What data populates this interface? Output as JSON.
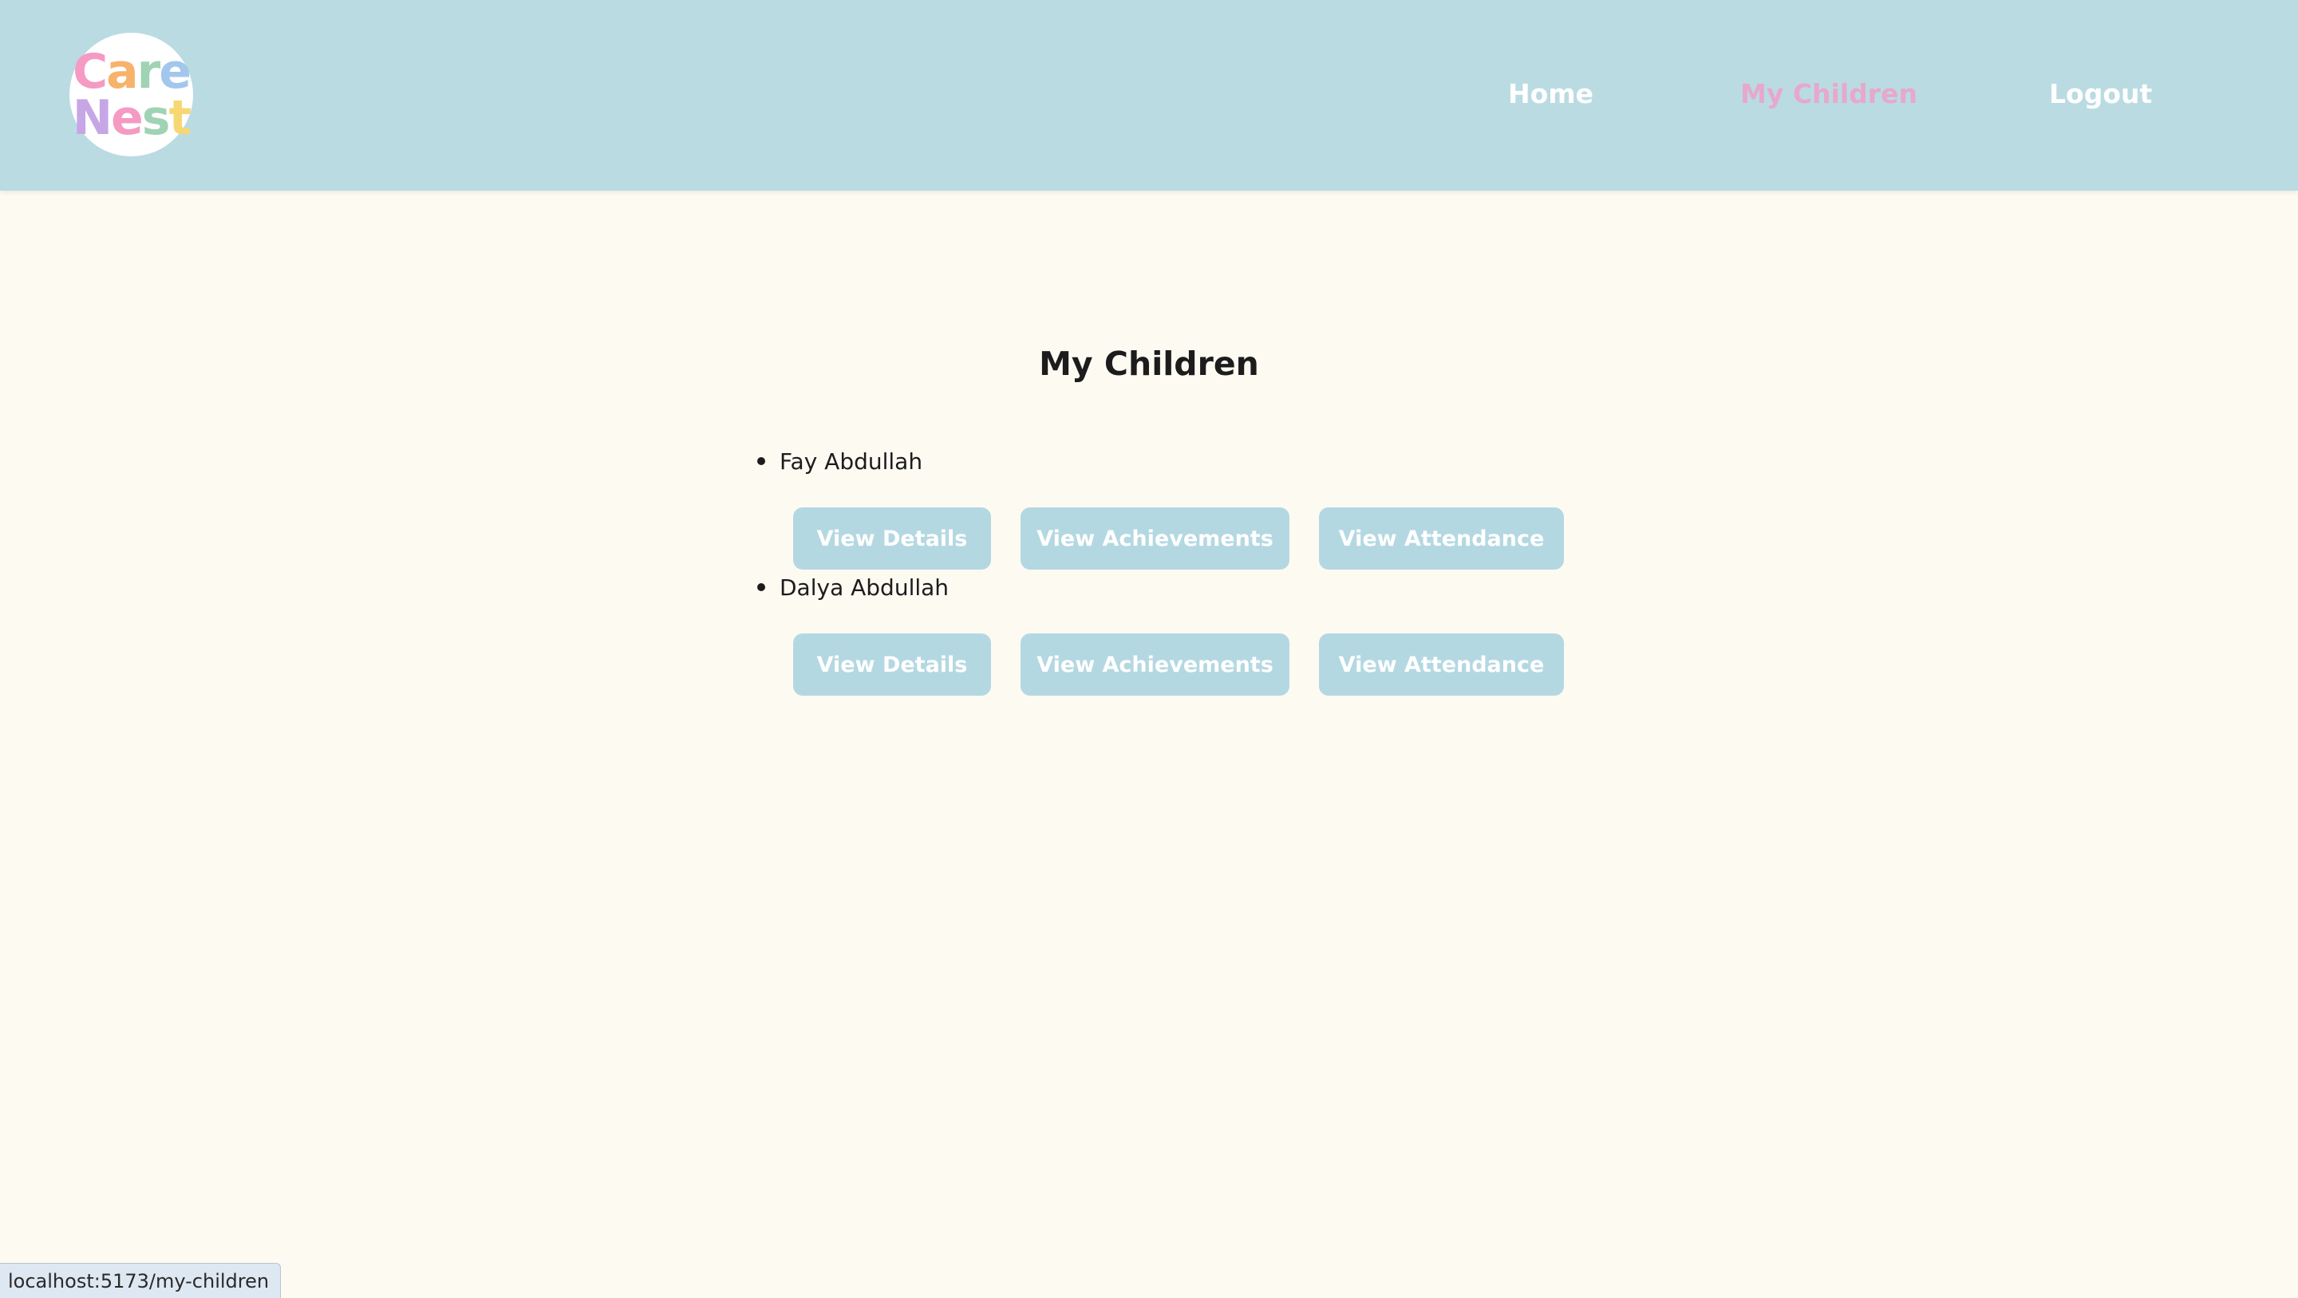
{
  "brand": {
    "logo_line1": "Care",
    "logo_line2": "Nest",
    "logo_colors": [
      "#f59ac3",
      "#f7b26b",
      "#9fd3b4",
      "#a3c7ec",
      "#f7d774"
    ]
  },
  "nav": {
    "items": [
      {
        "label": "Home",
        "active": false
      },
      {
        "label": "My Children",
        "active": true
      },
      {
        "label": "Logout",
        "active": false
      }
    ]
  },
  "main": {
    "title": "My Children",
    "children": [
      {
        "name": "Fay Abdullah",
        "buttons": {
          "details": "View Details",
          "achievements": "View Achievements",
          "attendance": "View Attendance"
        }
      },
      {
        "name": "Dalya Abdullah",
        "buttons": {
          "details": "View Details",
          "achievements": "View Achievements",
          "attendance": "View Attendance"
        }
      }
    ]
  },
  "status_bar": {
    "url": "localhost:5173/my-children"
  },
  "colors": {
    "header_bg": "#badbe2",
    "page_bg": "#fdfaf2",
    "active_nav": "#e7a8cb",
    "button_bg": "#b4d8e2"
  }
}
